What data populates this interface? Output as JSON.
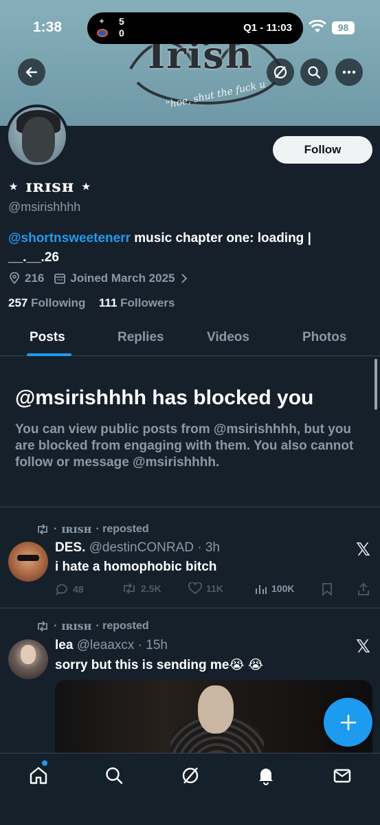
{
  "status_bar": {
    "time": "1:38",
    "score_top": "5",
    "score_bottom": "0",
    "game_status": "Q1 - 11:03",
    "battery": "98"
  },
  "banner": {
    "title": "Irish",
    "tagline": "\"hoe, shut the fuck u"
  },
  "profile": {
    "display_name": "⋆ ɪʀɪsʜ ⋆",
    "handle": "@msirishhhh",
    "follow_label": "Follow",
    "bio_mention": "@shortnsweetenerr",
    "bio_text_1": " music chapter one: loading |",
    "bio_text_2": "__.__.26",
    "location": "216",
    "joined": "Joined March 2025",
    "following_count": "257",
    "following_label": "Following",
    "followers_count": "111",
    "followers_label": "Followers"
  },
  "tabs": [
    "Posts",
    "Replies",
    "Videos",
    "Photos"
  ],
  "blocked": {
    "title": "@msirishhhh has blocked you",
    "text": "You can view public posts from @msirishhhh, but you are blocked from engaging with them. You also cannot follow or message @msirishhhh."
  },
  "posts": [
    {
      "repost_prefix": "·",
      "reposter": "ɪʀɪsʜ",
      "repost_label": "· reposted",
      "name": "DES.",
      "handle_time": "@destinCONRAD · 3h",
      "text": "i hate a homophobic bitch",
      "replies": "48",
      "reposts": "2.5K",
      "likes": "11K",
      "views": "100K"
    },
    {
      "repost_prefix": "·",
      "reposter": "ɪʀɪsʜ",
      "repost_label": "· reposted",
      "name": "lea",
      "handle_time": "@leaaxcx · 15h",
      "text": "sorry but this is sending me😭 😭"
    }
  ],
  "colors": {
    "background": "#15202b",
    "accent": "#1d9bf0",
    "muted_text": "#8b98a5",
    "divider": "#38444d"
  },
  "icons": {
    "back": "arrow-left-icon",
    "grok": "grok-icon",
    "search": "search-icon",
    "more": "more-icon",
    "location": "location-pin-icon",
    "calendar": "calendar-icon",
    "repost": "repost-icon",
    "reply": "reply-icon",
    "like": "heart-icon",
    "views": "views-icon",
    "bookmark": "bookmark-icon",
    "share": "share-icon",
    "home": "home-icon",
    "notifications": "bell-icon",
    "messages": "mail-icon",
    "compose": "plus-icon"
  }
}
